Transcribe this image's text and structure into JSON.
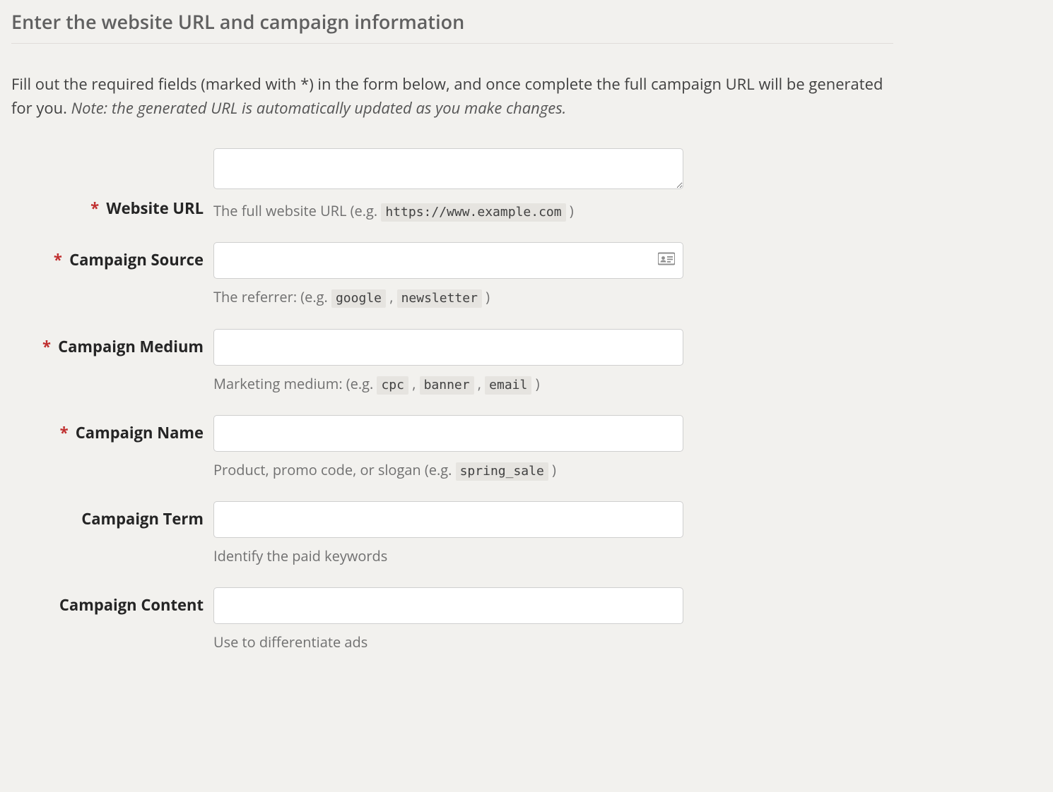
{
  "page": {
    "title": "Enter the website URL and campaign information",
    "intro_prefix": "Fill out the required fields (marked with *) in the form below, and once complete the full campaign URL will be generated for you. ",
    "intro_note": "Note: the generated URL is automatically updated as you make changes."
  },
  "fields": {
    "website_url": {
      "required": true,
      "label": "Website URL",
      "value": "",
      "help_prefix": "The full website URL (e.g. ",
      "help_code1": "https://www.example.com",
      "help_suffix": " )"
    },
    "campaign_source": {
      "required": true,
      "label": "Campaign Source",
      "value": "",
      "icon": "id-card-icon",
      "help_prefix": "The referrer: (e.g. ",
      "help_code1": "google",
      "help_sep1": " , ",
      "help_code2": "newsletter",
      "help_suffix": " )"
    },
    "campaign_medium": {
      "required": true,
      "label": "Campaign Medium",
      "value": "",
      "help_prefix": "Marketing medium: (e.g. ",
      "help_code1": "cpc",
      "help_sep1": " , ",
      "help_code2": "banner",
      "help_sep2": " , ",
      "help_code3": "email",
      "help_suffix": " )"
    },
    "campaign_name": {
      "required": true,
      "label": "Campaign Name",
      "value": "",
      "help_prefix": "Product, promo code, or slogan (e.g. ",
      "help_code1": "spring_sale",
      "help_suffix": " )"
    },
    "campaign_term": {
      "required": false,
      "label": "Campaign Term",
      "value": "",
      "help_text": "Identify the paid keywords"
    },
    "campaign_content": {
      "required": false,
      "label": "Campaign Content",
      "value": "",
      "help_text": "Use to differentiate ads"
    }
  },
  "symbols": {
    "required_mark": "*"
  }
}
